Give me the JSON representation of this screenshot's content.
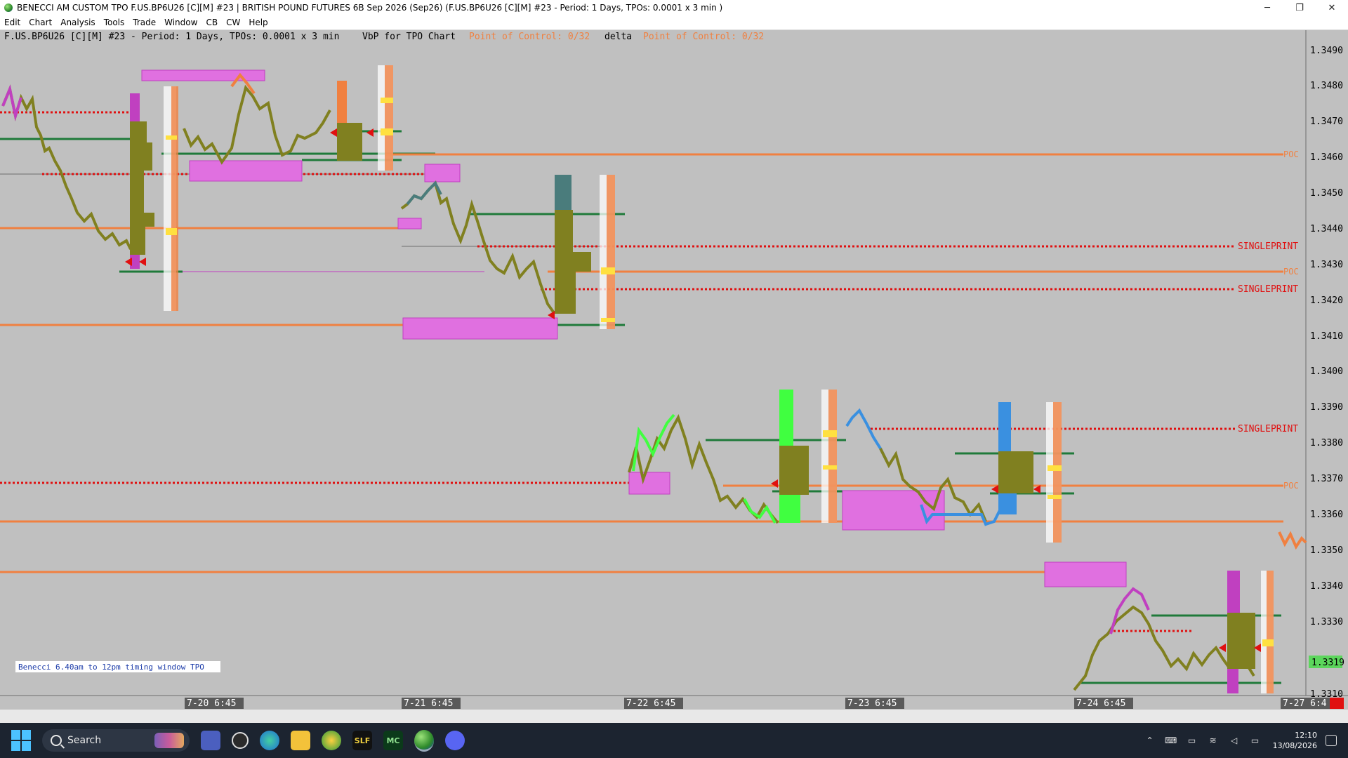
{
  "window": {
    "title": "BENECCI AM CUSTOM TPO F.US.BP6U26 [C][M] #23 | BRITISH POUND FUTURES 6B Sep 2026 (Sep26) (F.US.BP6U26 [C][M] #23 - Period: 1 Days, TPOs: 0.0001 x 3 min )",
    "minimize": "─",
    "restore": "❐",
    "close": "✕"
  },
  "menu": [
    "Edit",
    "Chart",
    "Analysis",
    "Tools",
    "Trade",
    "Window",
    "CB",
    "CW",
    "Help"
  ],
  "chart": {
    "header_symbol": "F.US.BP6U26 [C][M] #23 - Period: 1 Days, TPOs: 0.0001 x 3 min",
    "header_study1": "VbP for TPO Chart",
    "header_poc1": "Point of Control: 0/32",
    "header_study2": "delta",
    "header_poc2": "Point of Control: 0/32",
    "timing_label": "Benecci 6.40am to 12pm timing window TPO",
    "current_price": "1.3319",
    "price_ticks": [
      "1.3490",
      "1.3480",
      "1.3470",
      "1.3460",
      "1.3450",
      "1.3440",
      "1.3430",
      "1.3420",
      "1.3410",
      "1.3400",
      "1.3390",
      "1.3380",
      "1.3370",
      "1.3360",
      "1.3350",
      "1.3340",
      "1.3330",
      "1.3310"
    ],
    "time_ticks": [
      "7-20  6:45",
      "7-21  6:45",
      "7-22  6:45",
      "7-23  6:45",
      "7-24  6:45",
      "7-27  6:4"
    ],
    "level_labels": {
      "poc_a": "POC",
      "single_a": "SINGLEPRINT",
      "poc_b": "POC",
      "single_b": "SINGLEPRINT",
      "single_c": "SINGLEPRINT",
      "poc_c": "POC"
    },
    "colors": {
      "background": "#c0c0c0",
      "poc_line": "#f08040",
      "singleprint_line": "#e01010",
      "value_area_line": "#1f7a3a",
      "tpo_profile": "#808020",
      "range_box": "#e070e0",
      "current_price_bg": "#5cd65c"
    }
  },
  "taskbar": {
    "search_placeholder": "Search",
    "time": "12:10",
    "date": "13/08/2026",
    "apps": [
      "teams-icon",
      "maps-icon",
      "edge-icon",
      "explorer-icon",
      "browser-icon",
      "slf-icon",
      "mc-icon",
      "sierra-icon",
      "discord-icon"
    ],
    "slf_label": "SLF",
    "mc_label": "MC"
  }
}
